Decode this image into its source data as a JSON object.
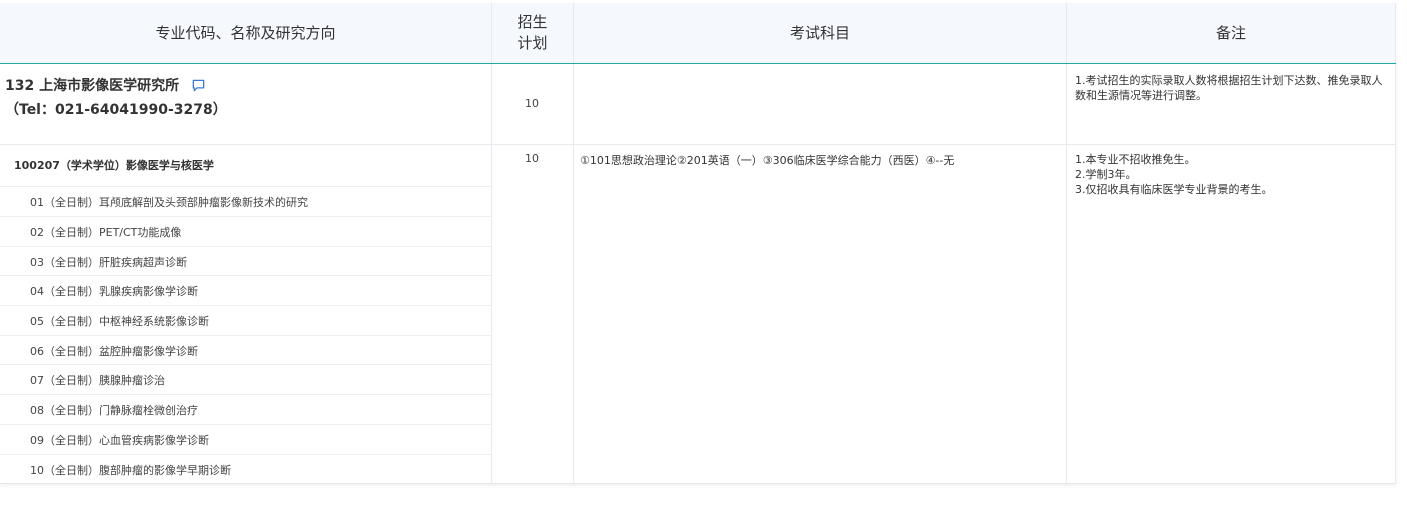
{
  "header": {
    "col_major": "专业代码、名称及研究方向",
    "col_plan_line1": "招生",
    "col_plan_line2": "计划",
    "col_subjects": "考试科目",
    "col_remarks": "备注"
  },
  "institute": {
    "title": "132 上海市影像医学研究所",
    "tel": "（Tel：021-64041990-3278）",
    "plan": "10",
    "subjects": "",
    "remark": "1.考试招生的实际录取人数将根据招生计划下达数、推免录取人数和生源情况等进行调整。",
    "icon": "chat-bubble-icon",
    "icon_color": "#3a7bd5"
  },
  "major": {
    "title": "100207（学术学位）影像医学与核医学",
    "plan": "10",
    "subjects": "①101思想政治理论②201英语（一）③306临床医学综合能力（西医）④--无",
    "remarks": [
      "1.本专业不招收推免生。",
      "2.学制3年。",
      "3.仅招收具有临床医学专业背景的考生。"
    ],
    "directions": [
      "01（全日制）耳颅底解剖及头颈部肿瘤影像新技术的研究",
      "02（全日制）PET/CT功能成像",
      "03（全日制）肝脏疾病超声诊断",
      "04（全日制）乳腺疾病影像学诊断",
      "05（全日制）中枢神经系统影像诊断",
      "06（全日制）盆腔肿瘤影像学诊断",
      "07（全日制）胰腺肿瘤诊治",
      "08（全日制）门静脉瘤栓微创治疗",
      "09（全日制）心血管疾病影像学诊断",
      "10（全日制）腹部肿瘤的影像学早期诊断"
    ]
  },
  "colors": {
    "header_bg": "#f5f8fc",
    "accent": "#20a8a8",
    "border": "#e6e9ee"
  }
}
